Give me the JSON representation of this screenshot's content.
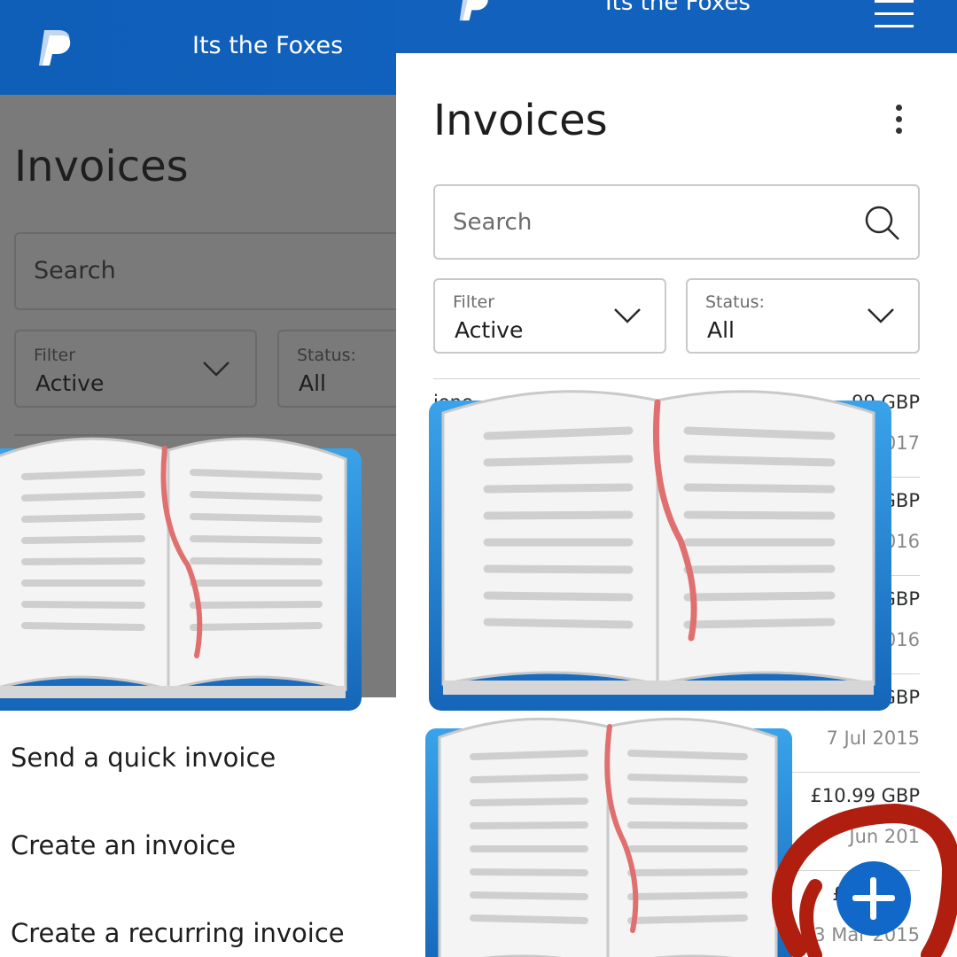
{
  "left_panel": {
    "header": {
      "title": "Its the Foxes",
      "logo_icon": "paypal-logo"
    },
    "page_title": "Invoices",
    "search": {
      "placeholder": "Search"
    },
    "filter": {
      "label": "Filter",
      "value": "Active"
    },
    "status": {
      "label": "Status:",
      "value": "All"
    },
    "menu": [
      {
        "label": "Send a quick invoice"
      },
      {
        "label": "Create an invoice"
      },
      {
        "label": "Create a recurring invoice"
      }
    ]
  },
  "right_panel": {
    "header": {
      "title": "Its the Foxes",
      "logo_icon": "paypal-logo",
      "menu_icon": "hamburger-menu-icon"
    },
    "page_title": "Invoices",
    "more_icon": "kebab-menu-icon",
    "search": {
      "placeholder": "Search",
      "icon": "search-icon"
    },
    "filter": {
      "label": "Filter",
      "value": "Active"
    },
    "status": {
      "label": "Status:",
      "value": "All"
    },
    "invoices": [
      {
        "name": "jone",
        "amount": ".99 GBP",
        "date": "017"
      },
      {
        "name": "",
        "amount": "GBP",
        "date": "016"
      },
      {
        "name": "",
        "amount": "GBP",
        "date": "016"
      },
      {
        "name": "",
        "amount": "GBP",
        "date": "7 Jul 2015"
      },
      {
        "name": "",
        "amount": "£10.99 GBP",
        "date": "Jun 201"
      },
      {
        "name": "",
        "amount": "£3",
        "date": "23 Mar 2015"
      }
    ],
    "fab_icon": "plus-icon"
  },
  "overlays": {
    "book_icon": "open-book-emoji",
    "highlight": "red-circle-scribble",
    "colors": {
      "brand_blue": "#1060bd",
      "fab_blue": "#1168c8",
      "scribble_red": "#b01e10"
    }
  }
}
